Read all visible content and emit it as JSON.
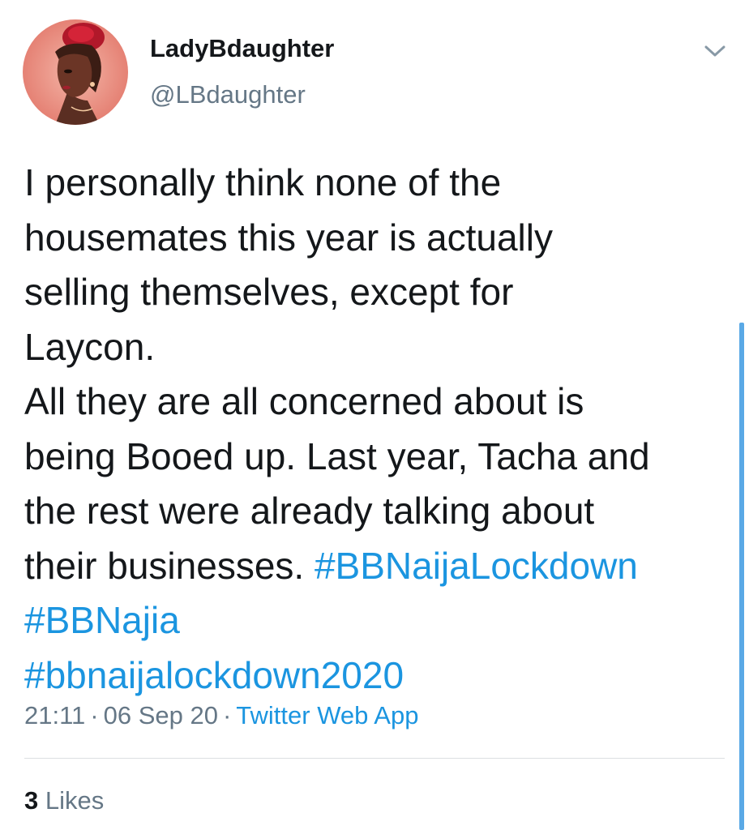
{
  "user": {
    "display_name": "LadyBdaughter",
    "handle": "@LBdaughter",
    "avatar_icon": "avatar-illustration-woman-red-hair"
  },
  "tweet": {
    "text_lines": [
      "I personally think none of the",
      "housemates this year is actually",
      "selling themselves, except for",
      "Laycon.",
      "All they are all concerned about is",
      "being Booed up. Last year, Tacha and",
      "the rest were already talking about",
      "their businesses. "
    ],
    "hashtags": [
      "#BBNaijaLockdown",
      "#BBNajia",
      "#bbnaijalockdown2020"
    ]
  },
  "meta": {
    "time": "21:11",
    "separator": "·",
    "date": "06 Sep 20",
    "source": "Twitter Web App"
  },
  "stats": {
    "likes_count": "3",
    "likes_label": "Likes"
  },
  "colors": {
    "link": "#1b95e0",
    "secondary_text": "#657786",
    "primary_text": "#14171a",
    "scrollbar": "#5aa9e6"
  },
  "icons": {
    "menu": "chevron-down-icon"
  }
}
